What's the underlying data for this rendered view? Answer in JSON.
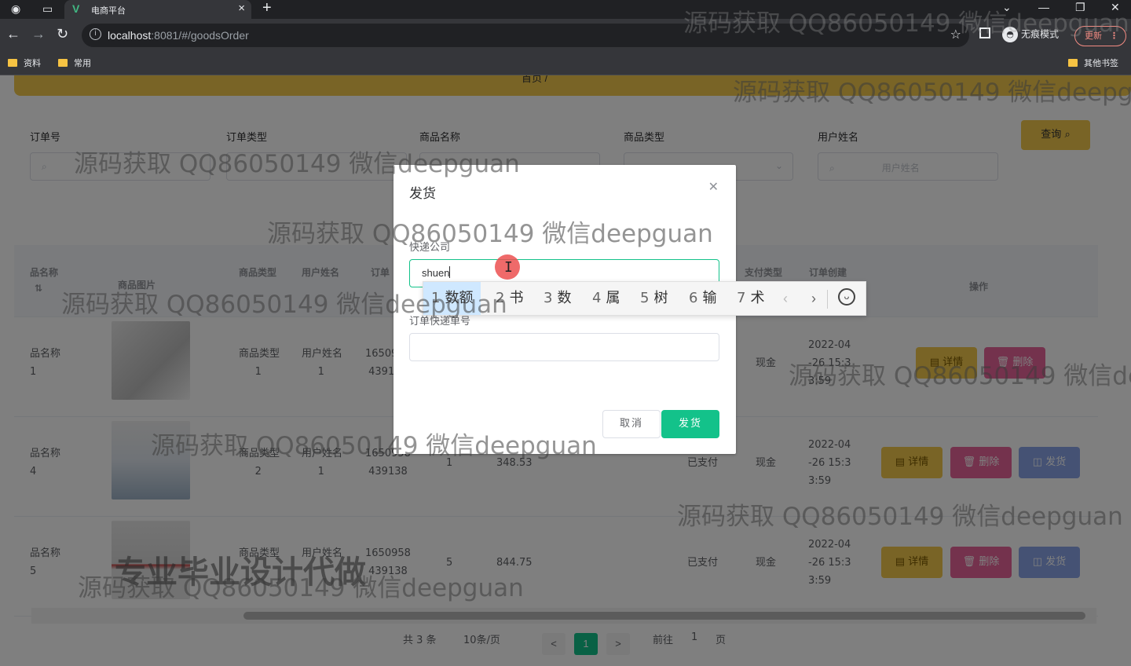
{
  "browser": {
    "tab_title": "电商平台",
    "tab_favicon": "V",
    "close_glyph": "×",
    "new_tab_glyph": "+",
    "url_host": "localhost",
    "url_rest": ":8081/#/goodsOrder",
    "incognito_label": "无痕模式",
    "update_label": "更新",
    "bookmarks": [
      "资料",
      "常用"
    ],
    "other_bookmarks": "其他书签"
  },
  "page": {
    "breadcrumb": "首页 /",
    "search": {
      "labels": [
        "订单号",
        "订单类型",
        "商品名称",
        "商品类型",
        "用户姓名"
      ],
      "user_placeholder": "用户姓名",
      "button": "查询"
    },
    "table": {
      "headers": {
        "goods_name": "品名称",
        "goods_image": "商品图片",
        "goods_type": "商品类型",
        "user_name": "用户姓名",
        "order": "订单",
        "pay_type": "支付类型",
        "order_created": "订单创建",
        "ops": "操作"
      },
      "rows": [
        {
          "name": "品名称",
          "name_no": "1",
          "type": "商品类型",
          "type_no": "1",
          "user": "用户姓名",
          "user_no": "1",
          "order_a": "16509",
          "order_b": "4391",
          "qty": "",
          "price": "",
          "status": "",
          "pay": "现金",
          "created_a": "2022-04",
          "created_b": "-26 15:3",
          "created_c": "3:59"
        },
        {
          "name": "品名称",
          "name_no": "4",
          "type": "商品类型",
          "type_no": "2",
          "user": "用户姓名",
          "user_no": "1",
          "order_a": "1650958",
          "order_b": "439138",
          "qty": "1",
          "price": "348.53",
          "status": "已支付",
          "pay": "现金",
          "created_a": "2022-04",
          "created_b": "-26 15:3",
          "created_c": "3:59"
        },
        {
          "name": "品名称",
          "name_no": "5",
          "type": "商品类型",
          "type_no": "",
          "user": "用户姓名",
          "user_no": "",
          "order_a": "1650958",
          "order_b": "439138",
          "qty": "5",
          "price": "844.75",
          "status": "已支付",
          "pay": "现金",
          "created_a": "2022-04",
          "created_b": "-26 15:3",
          "created_c": "3:59"
        }
      ],
      "actions": {
        "detail": "详情",
        "delete": "删除",
        "ship": "发货"
      }
    },
    "pager": {
      "total": "共 3 条",
      "size": "10条/页",
      "prev": "<",
      "current": "1",
      "next": ">",
      "goto": "前往",
      "goto_value": "1",
      "page_unit": "页"
    }
  },
  "dialog": {
    "title": "发货",
    "courier_label": "快递公司",
    "courier_value": "shuen",
    "tracking_label": "订单快递单号",
    "tracking_value": "",
    "cancel": "取消",
    "confirm": "发货"
  },
  "ime": {
    "candidates": [
      {
        "n": "1",
        "w": "数额"
      },
      {
        "n": "2",
        "w": "书"
      },
      {
        "n": "3",
        "w": "数"
      },
      {
        "n": "4",
        "w": "属"
      },
      {
        "n": "5",
        "w": "树"
      },
      {
        "n": "6",
        "w": "输"
      },
      {
        "n": "7",
        "w": "术"
      }
    ],
    "prev_glyph": "‹",
    "next_glyph": "›"
  },
  "watermarks": {
    "text": "源码获取 QQ86050149 微信deepguan",
    "text_cut_1": "源码获取 QQ86050149 微信deepgua",
    "text_cut_2": "源码获取 QQ86050149 微信dee",
    "big": "专业毕业设计代做"
  },
  "icons": [
    "back-arrow-icon",
    "forward-arrow-icon",
    "reload-icon",
    "info-icon",
    "star-icon",
    "close-icon",
    "search-icon",
    "emoji-icon"
  ]
}
